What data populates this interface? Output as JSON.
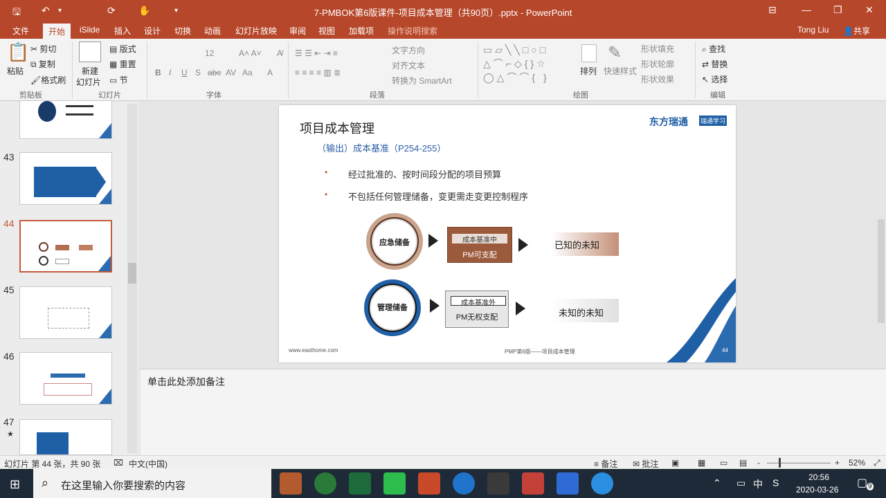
{
  "window": {
    "title": "7-PMBOK第6版课件-项目成本管理（共90页）.pptx  -  PowerPoint",
    "user": "Tong Liu",
    "share": "共享"
  },
  "tabs": [
    "文件",
    "开始",
    "iSlide",
    "插入",
    "设计",
    "切换",
    "动画",
    "幻灯片放映",
    "审阅",
    "视图",
    "加载项",
    "操作说明搜索"
  ],
  "ribbon": {
    "clipboard": {
      "paste": "粘贴",
      "cut": "剪切",
      "copy": "复制",
      "format_painter": "格式刷",
      "group": "剪贴板"
    },
    "slides": {
      "new_slide": "新建",
      "new_slide2": "幻灯片",
      "layout": "版式",
      "reset": "重置",
      "section": "节",
      "group": "幻灯片"
    },
    "font": {
      "size": "12",
      "group": "字体"
    },
    "paragraph": {
      "text_direction": "文字方向",
      "align_text": "对齐文本",
      "smartart": "转换为 SmartArt",
      "group": "段落"
    },
    "drawing": {
      "arrange": "排列",
      "quick_styles": "快速样式",
      "shape_fill": "形状填充",
      "shape_outline": "形状轮廓",
      "shape_effects": "形状效果",
      "group": "绘图"
    },
    "editing": {
      "find": "查找",
      "replace": "替换",
      "select": "选择",
      "group": "编辑"
    }
  },
  "thumbnails": [
    {
      "num": "",
      "selected": false
    },
    {
      "num": "43",
      "selected": false
    },
    {
      "num": "44",
      "selected": true
    },
    {
      "num": "45",
      "selected": false
    },
    {
      "num": "46",
      "selected": false
    },
    {
      "num": "47",
      "selected": false
    }
  ],
  "slide": {
    "title": "项目成本管理",
    "subtitle": "（输出）成本基准（P254-255）",
    "logo": "东方瑞通",
    "logo_badge": "瑞通学习",
    "bullets": [
      "经过批准的、按时间段分配的项目预算",
      "不包括任何管理储备，变更需走变更控制程序"
    ],
    "row1": {
      "circle": "应急储备",
      "box_top": "成本基准中",
      "box_bottom": "PM可支配",
      "result": "已知的未知"
    },
    "row2": {
      "circle": "管理储备",
      "box_top": "成本基准外",
      "box_bottom": "PM无权支配",
      "result": "未知的未知"
    },
    "footer_left": "www.easthome.com",
    "footer_center": "PMP第6版——项目成本管理",
    "page_number": "44"
  },
  "notes_placeholder": "单击此处添加备注",
  "status": {
    "slide_info": "幻灯片 第 44 张，共 90 张",
    "language": "中文(中国)",
    "notes": "备注",
    "comments": "批注",
    "zoom_minus": "-",
    "zoom_plus": "+",
    "zoom": "52%"
  },
  "taskbar": {
    "search_placeholder": "在这里输入你要搜索的内容",
    "ime": "中",
    "time": "20:56",
    "date": "2020-03-26",
    "notifications": "9"
  }
}
